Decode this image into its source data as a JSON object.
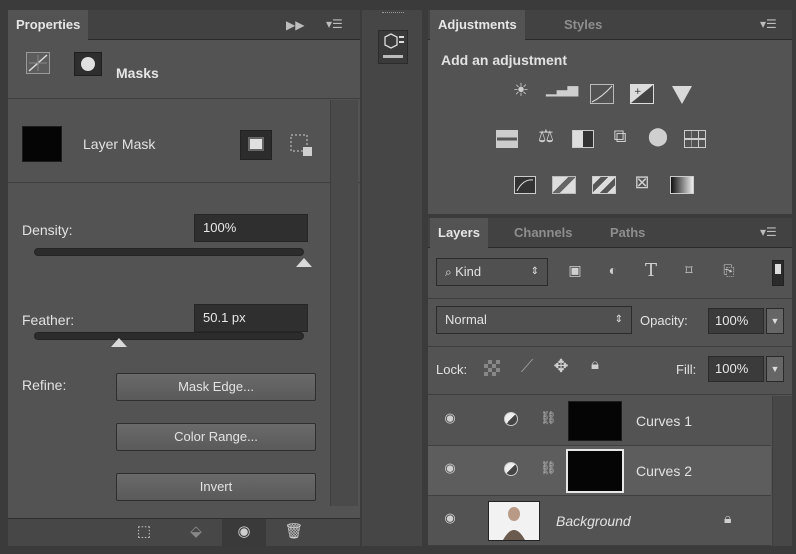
{
  "properties": {
    "tab_label": "Properties",
    "section_label": "Masks",
    "mask_type_label": "Layer Mask",
    "density_label": "Density:",
    "density_value": "100%",
    "density_level": 1.0,
    "feather_label": "Feather:",
    "feather_value": "50.1 px",
    "feather_level": 0.31,
    "refine_label": "Refine:",
    "mask_edge_button": "Mask Edge...",
    "color_range_button": "Color Range...",
    "invert_button": "Invert",
    "collapse_icon": "double-chevron-right-icon",
    "menu_icon": "panel-menu-icon"
  },
  "adjustments": {
    "tabs": [
      "Adjustments",
      "Styles"
    ],
    "heading": "Add an adjustment",
    "row1_icons": [
      "brightness-contrast-icon",
      "levels-icon",
      "curves-icon",
      "exposure-icon",
      "vibrance-icon"
    ],
    "row2_icons": [
      "hue-saturation-icon",
      "color-balance-icon",
      "black-white-icon",
      "photo-filter-icon",
      "channel-mixer-icon",
      "color-lookup-icon"
    ],
    "row3_icons": [
      "invert-icon",
      "posterize-icon",
      "threshold-icon",
      "selective-color-icon",
      "gradient-map-icon"
    ]
  },
  "layers": {
    "tabs": [
      "Layers",
      "Channels",
      "Paths"
    ],
    "filter_kind": "Kind",
    "blend_mode": "Normal",
    "opacity_label": "Opacity:",
    "opacity_value": "100%",
    "lock_label": "Lock:",
    "fill_label": "Fill:",
    "fill_value": "100%",
    "rows": [
      {
        "name": "Curves 1",
        "selected": false
      },
      {
        "name": "Curves 2",
        "selected": true
      },
      {
        "name": "Background",
        "selected": false
      }
    ]
  },
  "colors": {
    "panel_bg": "#535353",
    "tab_bg": "#424242",
    "field_bg": "#2f2f2f",
    "selected_row": "#5d5d5d"
  }
}
